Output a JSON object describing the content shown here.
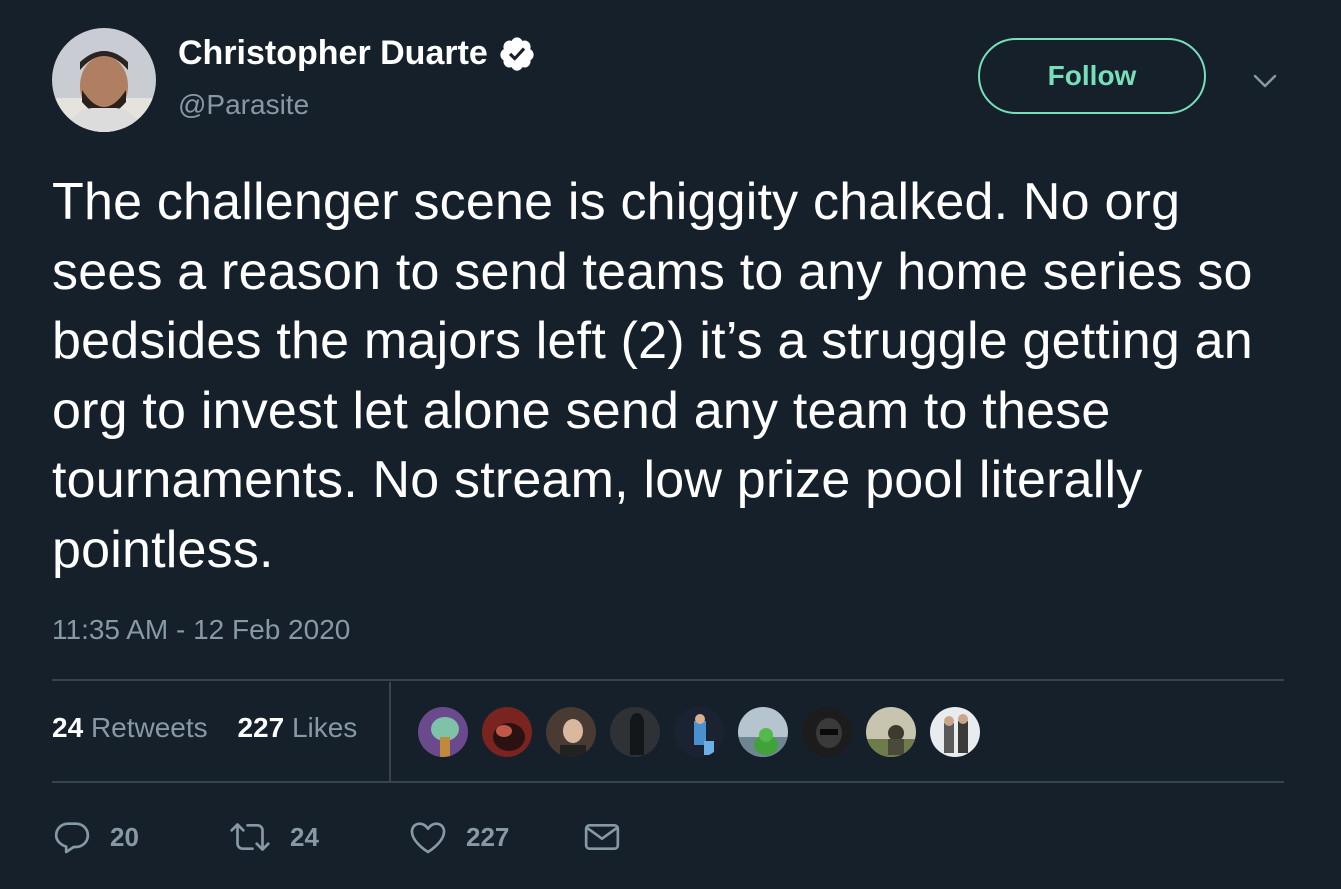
{
  "author": {
    "name": "Christopher Duarte",
    "handle": "@Parasite",
    "verified": true
  },
  "follow_button": {
    "label": "Follow"
  },
  "tweet": {
    "text": "The challenger scene is chiggity chalked. No org sees a reason to send teams to any home series so bedsides the majors left (2) it’s a struggle getting an org to invest let alone send any team to these tournaments. No stream, low prize pool literally pointless.",
    "timestamp": "11:35 AM - 12 Feb 2020"
  },
  "stats": {
    "retweets_count": "24",
    "retweets_label": "Retweets",
    "likes_count": "227",
    "likes_label": "Likes"
  },
  "actions": {
    "reply_count": "20",
    "retweet_count": "24",
    "like_count": "227"
  },
  "icons": {
    "verified": "verified-badge-icon",
    "caret": "chevron-down-icon",
    "reply": "reply-icon",
    "retweet": "retweet-icon",
    "like": "heart-icon",
    "dm": "envelope-icon"
  },
  "colors": {
    "background": "#15202b",
    "follow_accent": "#77dfb9",
    "secondary_text": "#8899a6",
    "divider": "#38444d"
  }
}
